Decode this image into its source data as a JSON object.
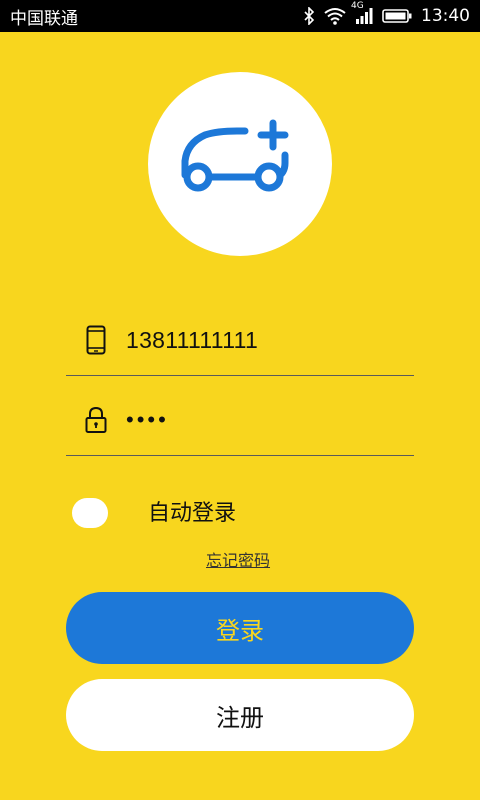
{
  "status_bar": {
    "carrier": "中国联通",
    "network": "4G",
    "time": "13:40"
  },
  "logo": {
    "icon": "car-plus-icon",
    "color": "#1d78d8"
  },
  "phone_field": {
    "icon": "phone-icon",
    "value": "13811111111"
  },
  "password_field": {
    "icon": "lock-icon",
    "value": "••••"
  },
  "auto_login": {
    "label": "自动登录",
    "checked": false
  },
  "forgot_password": "忘记密码",
  "login_button": "登录",
  "register_button": "注册",
  "colors": {
    "background": "#f8d61e",
    "primary": "#1d78d8"
  }
}
